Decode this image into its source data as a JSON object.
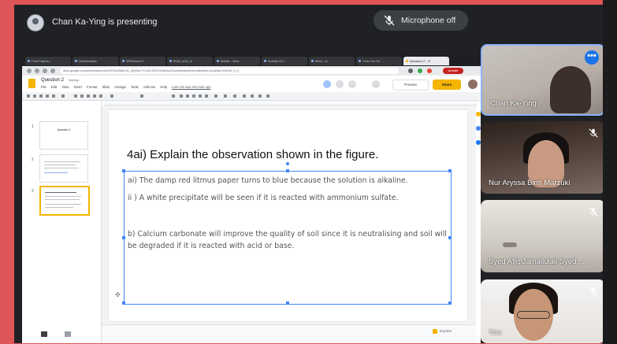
{
  "meet": {
    "presenting_text": "Chan Ka-Ying is presenting",
    "mic_status": "Microphone off",
    "participants": [
      {
        "name": "Chan Ka-Ying",
        "muted": false
      },
      {
        "name": "Nur Aryssa Binti Marzuki",
        "muted": true
      },
      {
        "name": "Syed Afiq Jamallulail Syed ...",
        "muted": true
      },
      {
        "name": "You",
        "muted": true
      }
    ],
    "more_label": "•••"
  },
  "browser": {
    "tabs": [
      "Past Papers |",
      "Mathematics",
      "WSDetect D",
      "5040_w16_m",
      "Mobile - Dow",
      "Activity 10.1",
      "Meet - ct",
      "Chan Ka-Yin",
      "Question 2 - G"
    ],
    "url": "docs.google.com/presentation/d/1WFk3L5MdhnG_Qhe5hzTYLkZL9D3SVnBDsdG2uwaNaIqvfhe4u/edit#slide=id.g56ac7e3c0f0_0_5",
    "update_label": "Update"
  },
  "slides_app": {
    "doc_title": "Question 2",
    "saving": "Saving...",
    "menu": [
      "File",
      "Edit",
      "View",
      "Insert",
      "Format",
      "Slide",
      "Arrange",
      "Tools",
      "Add-ons",
      "Help"
    ],
    "last_edit": "Last edit was seconds ago",
    "present_label": "Present",
    "share_label": "Share",
    "explore_label": "Explore",
    "thumbnails": [
      {
        "num": "1",
        "title": "Question 2"
      },
      {
        "num": "2",
        "title": ""
      },
      {
        "num": "3",
        "title": ""
      }
    ]
  },
  "slide": {
    "title": "4ai)  Explain the observation shown in the figure.",
    "line1": "ai) The damp red litmus paper turns to blue because the solution is alkaline.",
    "line2": "ii ) A white precipitate will be seen if it is reacted with ammonium sulfate.",
    "line3": "b) Calcium carbonate will improve the quality of soil since it is neutralising and soil will be degraded if it is reacted with acid or base."
  },
  "colors": {
    "accent_red": "#e05558",
    "meet_bg": "#202124",
    "slides_yellow": "#f4b400",
    "selection_blue": "#4285f4"
  }
}
